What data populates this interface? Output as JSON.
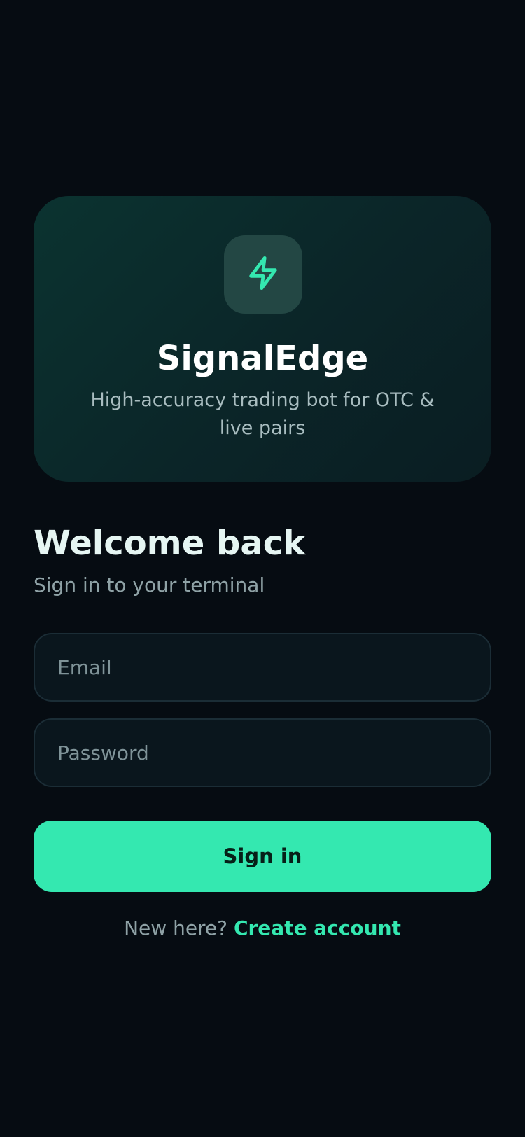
{
  "brand": {
    "name": "SignalEdge",
    "tagline": "High-accuracy trading bot for OTC & live pairs",
    "logo_icon": "lightning-bolt-icon",
    "accent_color": "#34e8b0"
  },
  "auth": {
    "title": "Welcome back",
    "subtitle": "Sign in to your terminal",
    "email": {
      "placeholder": "Email",
      "value": ""
    },
    "password": {
      "placeholder": "Password",
      "value": ""
    },
    "submit_label": "Sign in",
    "signup_prompt": "New here?",
    "signup_link": "Create account"
  }
}
